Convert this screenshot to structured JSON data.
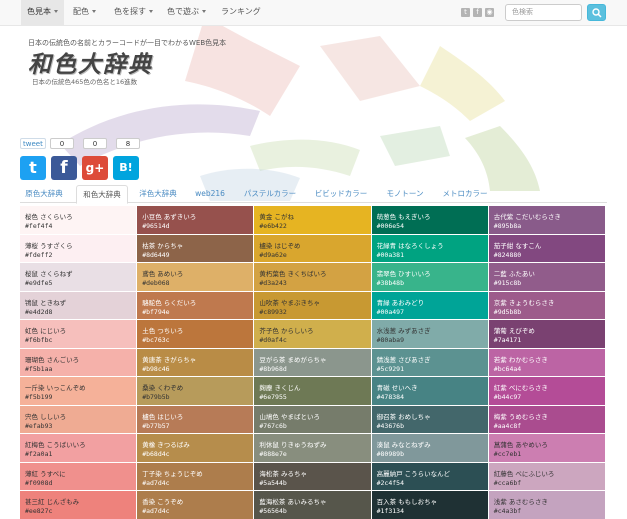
{
  "nav": {
    "items": [
      {
        "label": "色見本",
        "dropdown": true,
        "active": true
      },
      {
        "label": "配色",
        "dropdown": true,
        "active": false
      },
      {
        "label": "色を探す",
        "dropdown": true,
        "active": false
      },
      {
        "label": "色で遊ぶ",
        "dropdown": true,
        "active": false
      },
      {
        "label": "ランキング",
        "dropdown": false,
        "active": false
      }
    ],
    "social_icons": [
      "twitter-icon",
      "facebook-icon",
      "rss-icon"
    ],
    "search_placeholder": "色検索"
  },
  "hero": {
    "tagline": "日本の伝統色の名前とカラーコードが一目でわかるWEB色見本",
    "logo": "和色大辞典",
    "subtitle": "日本の伝統色465色の色名と16進数"
  },
  "share": {
    "tweet_label": "tweet",
    "counts": [
      "0",
      "0",
      "8"
    ],
    "icons": [
      {
        "name": "twitter-icon",
        "glyph": "t",
        "color": "#1da1f2"
      },
      {
        "name": "facebook-icon",
        "glyph": "f",
        "color": "#3b5998"
      },
      {
        "name": "google-plus-icon",
        "glyph": "g+",
        "color": "#dd4b39"
      },
      {
        "name": "hatena-bookmark-icon",
        "glyph": "B!",
        "color": "#00a4de"
      }
    ]
  },
  "tabs": [
    "原色大辞典",
    "和色大辞典",
    "洋色大辞典",
    "web216",
    "パステルカラー",
    "ビビッドカラー",
    "モノトーン",
    "メトロカラー"
  ],
  "active_tab": 1,
  "colors": [
    [
      {
        "name": "桜色 さくらいろ",
        "code": "#fef4f4"
      },
      {
        "name": "薄桜 うすざくら",
        "code": "#fdeff2"
      },
      {
        "name": "桜鼠 さくらねず",
        "code": "#e9dfe5"
      },
      {
        "name": "鴇鼠 ときねず",
        "code": "#e4d2d8"
      },
      {
        "name": "虹色 にじいろ",
        "code": "#f6bfbc"
      },
      {
        "name": "珊瑚色 さんごいろ",
        "code": "#f5b1aa"
      },
      {
        "name": "一斤染 いっこんぞめ",
        "code": "#f5b199"
      },
      {
        "name": "宍色 ししいろ",
        "code": "#efab93"
      },
      {
        "name": "紅梅色 こうばいいろ",
        "code": "#f2a0a1"
      },
      {
        "name": "薄紅 うすべに",
        "code": "#f0908d"
      },
      {
        "name": "甚三紅 じんざもみ",
        "code": "#ee827c"
      }
    ],
    [
      {
        "name": "小豆色 あずきいろ",
        "code": "#96514d"
      },
      {
        "name": "枯茶 からちゃ",
        "code": "#8d6449"
      },
      {
        "name": "鳶色 あめいろ",
        "code": "#deb068"
      },
      {
        "name": "駱駝色 らくだいろ",
        "code": "#bf794e"
      },
      {
        "name": "土色 つちいろ",
        "code": "#bc763c"
      },
      {
        "name": "黄唐茶 きがらちゃ",
        "code": "#b98c46"
      },
      {
        "name": "桑染 くわぞめ",
        "code": "#b79b5b"
      },
      {
        "name": "櫨色 はじいろ",
        "code": "#b77b57"
      },
      {
        "name": "黄橡 きつるばみ",
        "code": "#b68d4c"
      },
      {
        "name": "丁子染 ちょうじぞめ",
        "code": "#ad7d4c"
      },
      {
        "name": "香染 こうぞめ",
        "code": "#ad7d4c"
      }
    ],
    [
      {
        "name": "黄金 こがね",
        "code": "#e6b422"
      },
      {
        "name": "櫨染 はじぞめ",
        "code": "#d9a62e"
      },
      {
        "name": "黄朽葉色 きくちばいろ",
        "code": "#d3a243"
      },
      {
        "name": "山吹茶 やまぶきちゃ",
        "code": "#c89932"
      },
      {
        "name": "芥子色 からしいろ",
        "code": "#d0af4c"
      },
      {
        "name": "豆がら茶 まめがらちゃ",
        "code": "#8b968d"
      },
      {
        "name": "麹塵 きくじん",
        "code": "#6e7955"
      },
      {
        "name": "山鳩色 やまばといろ",
        "code": "#767c6b"
      },
      {
        "name": "利休鼠 りきゅうねずみ",
        "code": "#888e7e"
      },
      {
        "name": "海松茶 みるちゃ",
        "code": "#5a544b"
      },
      {
        "name": "藍海松茶 あいみるちゃ",
        "code": "#56564b"
      }
    ],
    [
      {
        "name": "萌葱色 もえぎいろ",
        "code": "#006e54"
      },
      {
        "name": "花緑青 はなろくしょう",
        "code": "#00a381"
      },
      {
        "name": "翡翠色 ひすいいろ",
        "code": "#38b48b"
      },
      {
        "name": "青緑 あおみどり",
        "code": "#00a497"
      },
      {
        "name": "水浅葱 みずあさぎ",
        "code": "#80aba9"
      },
      {
        "name": "錆浅葱 さびあさぎ",
        "code": "#5c9291"
      },
      {
        "name": "青磁 せいへき",
        "code": "#478384"
      },
      {
        "name": "御召茶 おめしちゃ",
        "code": "#43676b"
      },
      {
        "name": "湊鼠 みなとねずみ",
        "code": "#80989b"
      },
      {
        "name": "高麗納戸 こうらいなんど",
        "code": "#2c4f54"
      },
      {
        "name": "百入茶 ももしおちゃ",
        "code": "#1f3134"
      }
    ],
    [
      {
        "name": "古代紫 こだいむらさき",
        "code": "#895b8a"
      },
      {
        "name": "茄子紺 なすこん",
        "code": "#824880"
      },
      {
        "name": "二藍 ふたあい",
        "code": "#915c8b"
      },
      {
        "name": "京紫 きょうむらさき",
        "code": "#9d5b8b"
      },
      {
        "name": "蒲葡 えびぞめ",
        "code": "#7a4171"
      },
      {
        "name": "若紫 わかむらさき",
        "code": "#bc64a4"
      },
      {
        "name": "紅紫 べにむらさき",
        "code": "#b44c97"
      },
      {
        "name": "梅紫 うめむらさき",
        "code": "#aa4c8f"
      },
      {
        "name": "菖蒲色 あやめいろ",
        "code": "#cc7eb1"
      },
      {
        "name": "紅藤色 べにふじいろ",
        "code": "#cca6bf"
      },
      {
        "name": "浅紫 あさむらさき",
        "code": "#c4a3bf"
      }
    ]
  ]
}
